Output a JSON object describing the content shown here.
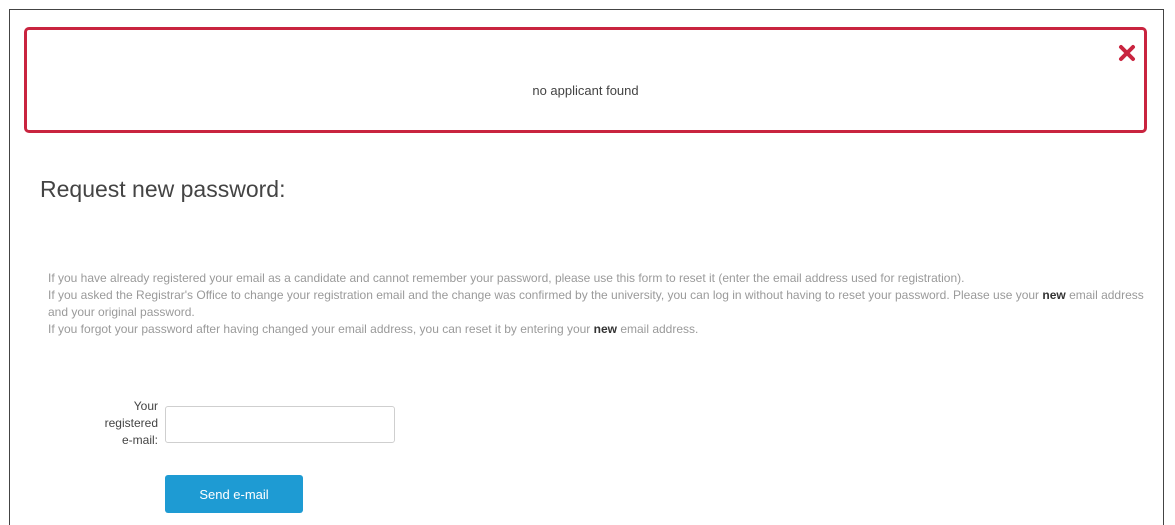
{
  "alert": {
    "message": "no applicant found",
    "close_icon": "close-icon",
    "color": "#c9243f"
  },
  "page": {
    "title": "Request new password:"
  },
  "info": {
    "para1": "If you have already registered your email as a candidate and cannot remember your password, please use this form to reset it (enter the email address used for registration).",
    "para2_before": "If you asked the Registrar's Office to change your registration email and the change was confirmed by the university, you can log in without having to reset your password. Please use your ",
    "para2_bold": "new",
    "para2_after": " email address and your original password.",
    "para3_before": "If you forgot your password after having changed your email address, you can reset it by entering your ",
    "para3_bold": "new",
    "para3_after": " email address."
  },
  "form": {
    "label_line1": "Your",
    "label_line2": "registered",
    "label_line3": "e-mail:",
    "email_value": "",
    "submit_label": "Send e-mail",
    "button_color": "#1e9bd3"
  }
}
